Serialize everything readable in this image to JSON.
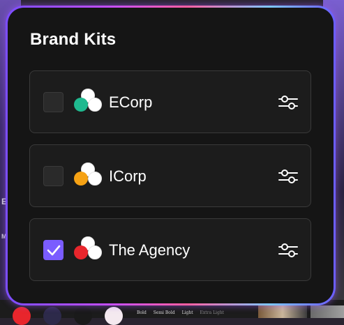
{
  "title": "Brand Kits",
  "kits": [
    {
      "name": "ECorp",
      "checked": false,
      "accent": "#1fb98f"
    },
    {
      "name": "ICorp",
      "checked": false,
      "accent": "#f6a214"
    },
    {
      "name": "The Agency",
      "checked": true,
      "accent": "#e8262c"
    }
  ],
  "background": {
    "edge_letters": [
      "E",
      "M"
    ],
    "font_weights": [
      "Bold",
      "Semi Bold",
      "Light",
      "Extra Light"
    ]
  },
  "colors": {
    "panel_bg": "#151515",
    "card_bg": "#1c1c1c",
    "checkbox_checked": "#7a5cff",
    "border_gradient": [
      "#7b4dff",
      "#c14dff",
      "#ff5fa2",
      "#7ec8ff",
      "#6b5cff"
    ]
  },
  "icons": {
    "settings": "sliders-icon",
    "check": "check-icon"
  }
}
